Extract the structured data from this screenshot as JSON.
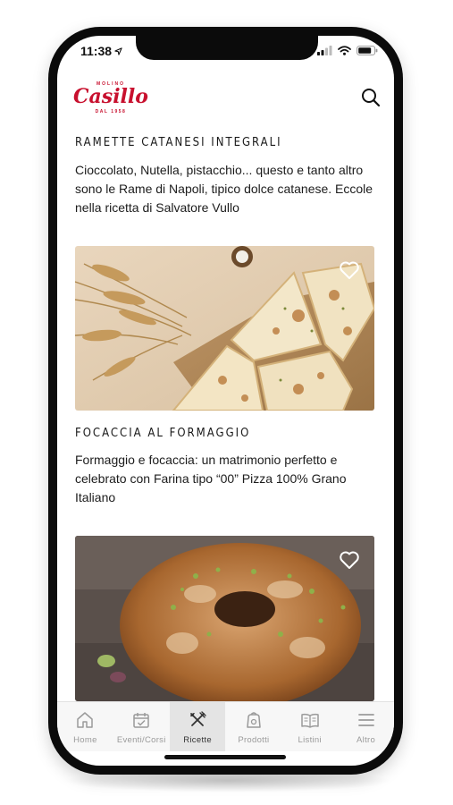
{
  "status_bar": {
    "time": "11:38",
    "location_icon": "location-arrow-icon",
    "signal_icon": "signal-bars-icon",
    "wifi_icon": "wifi-icon",
    "battery_icon": "battery-icon"
  },
  "header": {
    "logo_top": "MOLINO",
    "logo_brand": "Casillo",
    "logo_bottom": "DAL 1958",
    "search_icon": "search-icon",
    "brand_color": "#c8102e"
  },
  "recipes": [
    {
      "title": "RAMETTE CATANESI INTEGRALI",
      "description": "Cioccolato, Nutella, pistacchio... questo e tanto altro sono le Rame di Napoli, tipico dolce catanese. Eccole nella ricetta di Salvatore Vullo"
    },
    {
      "title": "FOCACCIA AL FORMAGGIO",
      "description": "Formaggio e focaccia: un matrimonio perfetto e celebrato con Farina tipo “00” Pizza 100% Grano Italiano",
      "image": "focaccia-wheat-photo",
      "favorite_icon": "heart-outline-icon"
    },
    {
      "image": "ciambella-pistachio-photo",
      "favorite_icon": "heart-outline-icon"
    }
  ],
  "tabbar": {
    "items": [
      {
        "label": "Home",
        "icon": "home-icon"
      },
      {
        "label": "Eventi/Corsi",
        "icon": "calendar-check-icon"
      },
      {
        "label": "Ricette",
        "icon": "fork-knife-icon",
        "active": true
      },
      {
        "label": "Prodotti",
        "icon": "bag-icon"
      },
      {
        "label": "Listini",
        "icon": "book-open-icon"
      },
      {
        "label": "Altro",
        "icon": "menu-icon"
      }
    ]
  }
}
